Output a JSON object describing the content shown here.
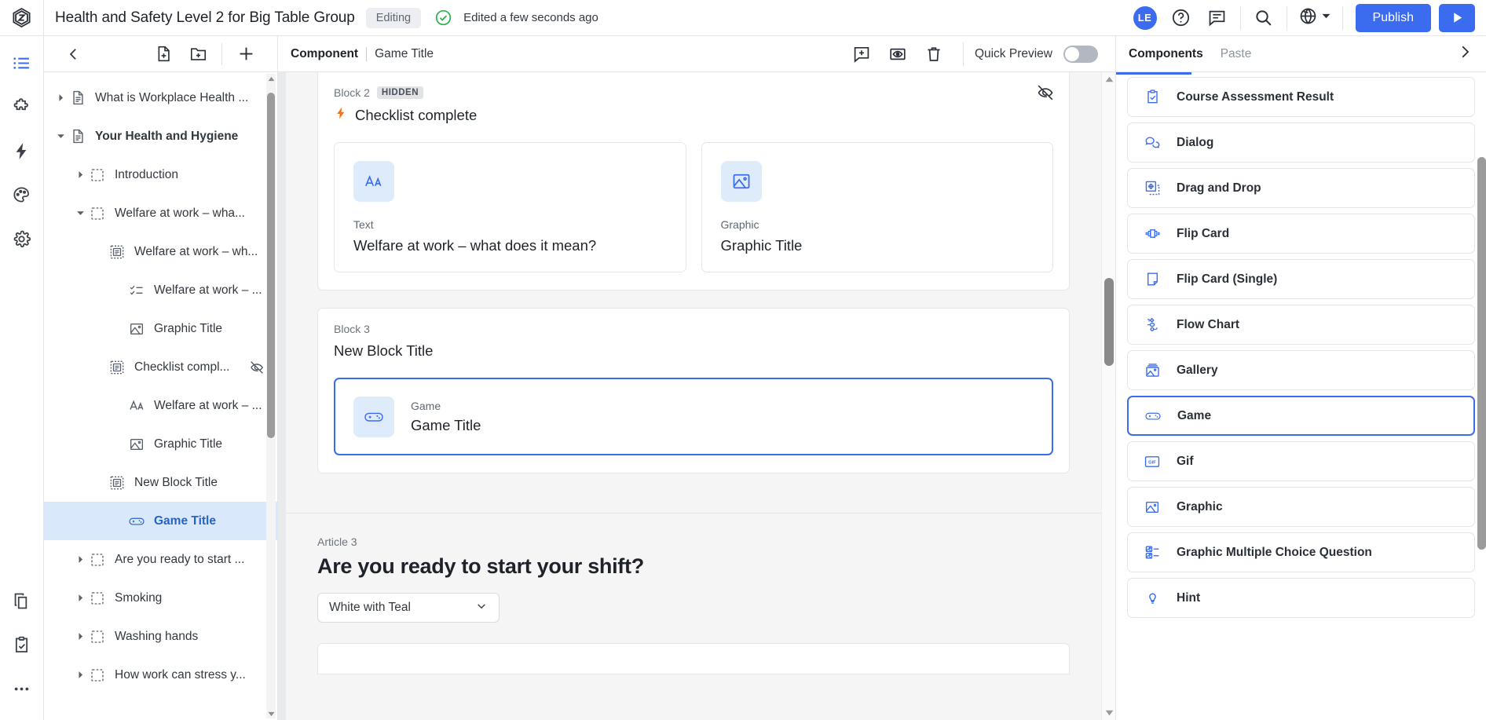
{
  "header": {
    "logo_icon": "hexagon-logo-icon",
    "doc_title": "Health and Safety Level 2 for Big Table Group",
    "editing_chip": "Editing",
    "saved_icon": "check-circle-icon",
    "edited_status": "Edited a few seconds ago",
    "avatar_initials": "LE",
    "help_icon": "help-circle-icon",
    "comment_icon": "comment-icon",
    "search_icon": "search-icon",
    "globe_icon": "globe-icon",
    "globe_caret_icon": "chevron-down-icon",
    "publish_label": "Publish",
    "preview_icon": "play-icon",
    "accent_color": "#3b6cf0"
  },
  "rail": {
    "items": [
      {
        "name": "outline-icon",
        "active": true
      },
      {
        "name": "puzzle-icon",
        "active": false
      },
      {
        "name": "bolt-icon",
        "active": false
      },
      {
        "name": "palette-icon",
        "active": false
      },
      {
        "name": "gear-icon",
        "active": false
      }
    ],
    "bottom_items": [
      {
        "name": "copy-pages-icon"
      },
      {
        "name": "clipboard-check-icon"
      },
      {
        "name": "more-horizontal-icon"
      }
    ]
  },
  "tree_toolbar": {
    "back_icon": "chevron-left-icon",
    "new_page_icon": "new-page-icon",
    "new_folder_icon": "new-folder-icon",
    "add_icon": "plus-icon"
  },
  "tree": {
    "items": [
      {
        "label": "What is Workplace Health ...",
        "icon": "page-icon",
        "indent": 0,
        "caret": "right",
        "bold": false,
        "selected": false,
        "hidden_flag": false
      },
      {
        "label": "Your Health and Hygiene",
        "icon": "page-icon",
        "indent": 0,
        "caret": "down",
        "bold": true,
        "selected": false,
        "hidden_flag": false
      },
      {
        "label": "Introduction",
        "icon": "block-icon",
        "indent": 1,
        "caret": "right",
        "bold": false,
        "selected": false,
        "hidden_flag": false
      },
      {
        "label": "Welfare at work – wha...",
        "icon": "block-icon",
        "indent": 1,
        "caret": "down",
        "bold": false,
        "selected": false,
        "hidden_flag": false
      },
      {
        "label": "Welfare at work – wh...",
        "icon": "inner-block-icon",
        "indent": 2,
        "caret": "none",
        "bold": false,
        "selected": false,
        "hidden_flag": false
      },
      {
        "label": "Welfare at work – ...",
        "icon": "checklist-icon",
        "indent": 3,
        "caret": "none",
        "bold": false,
        "selected": false,
        "hidden_flag": false
      },
      {
        "label": "Graphic Title",
        "icon": "graphic-icon",
        "indent": 3,
        "caret": "none",
        "bold": false,
        "selected": false,
        "hidden_flag": false
      },
      {
        "label": "Checklist compl...",
        "icon": "inner-block-icon",
        "indent": 2,
        "caret": "none",
        "bold": false,
        "selected": false,
        "hidden_flag": true
      },
      {
        "label": "Welfare at work – ...",
        "icon": "text-icon",
        "indent": 3,
        "caret": "none",
        "bold": false,
        "selected": false,
        "hidden_flag": false
      },
      {
        "label": "Graphic Title",
        "icon": "graphic-icon",
        "indent": 3,
        "caret": "none",
        "bold": false,
        "selected": false,
        "hidden_flag": false
      },
      {
        "label": "New Block Title",
        "icon": "inner-block-icon",
        "indent": 2,
        "caret": "none",
        "bold": false,
        "selected": false,
        "hidden_flag": false
      },
      {
        "label": "Game Title",
        "icon": "game-icon",
        "indent": 3,
        "caret": "none",
        "bold": true,
        "selected": true,
        "hidden_flag": false
      },
      {
        "label": "Are you ready to start ...",
        "icon": "block-icon",
        "indent": 1,
        "caret": "right",
        "bold": false,
        "selected": false,
        "hidden_flag": false
      },
      {
        "label": "Smoking",
        "icon": "block-icon",
        "indent": 1,
        "caret": "right",
        "bold": false,
        "selected": false,
        "hidden_flag": false
      },
      {
        "label": "Washing hands",
        "icon": "block-icon",
        "indent": 1,
        "caret": "right",
        "bold": false,
        "selected": false,
        "hidden_flag": false
      },
      {
        "label": "How work can stress y...",
        "icon": "block-icon",
        "indent": 1,
        "caret": "right",
        "bold": false,
        "selected": false,
        "hidden_flag": false
      }
    ]
  },
  "canvas_toolbar": {
    "breadcrumb_type": "Component",
    "breadcrumb_name": "Game Title",
    "add_comment_icon": "add-comment-icon",
    "preview_icon": "eye-box-icon",
    "delete_icon": "trash-icon",
    "quick_preview_label": "Quick Preview",
    "quick_preview_on": false
  },
  "canvas": {
    "block2": {
      "kicker": "Block 2",
      "hidden_badge": "HIDDEN",
      "title": "Checklist complete",
      "title_icon": "bolt-icon",
      "hidden_eye_icon": "eye-off-icon",
      "components": [
        {
          "kind": "Text",
          "title": "Welfare at work – what does it mean?",
          "icon": "text-icon",
          "selected": false
        },
        {
          "kind": "Graphic",
          "title": "Graphic Title",
          "icon": "graphic-icon",
          "selected": false
        }
      ]
    },
    "block3": {
      "kicker": "Block 3",
      "title": "New Block Title",
      "components": [
        {
          "kind": "Game",
          "title": "Game Title",
          "icon": "game-icon",
          "selected": true
        }
      ]
    },
    "article3": {
      "kicker": "Article 3",
      "title": "Are you ready to start your shift?",
      "theme_select_value": "White with Teal",
      "theme_select_caret": "chevron-down-icon"
    }
  },
  "right_panel": {
    "tabs": [
      {
        "label": "Components",
        "active": true
      },
      {
        "label": "Paste",
        "active": false
      }
    ],
    "collapse_icon": "chevron-right-icon",
    "items": [
      {
        "label": "Course Assessment Result",
        "icon": "clipboard-check-icon",
        "selected": false
      },
      {
        "label": "Dialog",
        "icon": "dialog-icon",
        "selected": false
      },
      {
        "label": "Drag and Drop",
        "icon": "drag-drop-icon",
        "selected": false
      },
      {
        "label": "Flip Card",
        "icon": "flip-card-icon",
        "selected": false
      },
      {
        "label": "Flip Card (Single)",
        "icon": "flip-card-single-icon",
        "selected": false
      },
      {
        "label": "Flow Chart",
        "icon": "flow-chart-icon",
        "selected": false
      },
      {
        "label": "Gallery",
        "icon": "gallery-icon",
        "selected": false
      },
      {
        "label": "Game",
        "icon": "game-icon",
        "selected": true
      },
      {
        "label": "Gif",
        "icon": "gif-icon",
        "selected": false
      },
      {
        "label": "Graphic",
        "icon": "graphic-icon",
        "selected": false
      },
      {
        "label": "Graphic Multiple Choice Question",
        "icon": "graphic-mcq-icon",
        "selected": false
      },
      {
        "label": "Hint",
        "icon": "lightbulb-icon",
        "selected": false
      }
    ]
  }
}
